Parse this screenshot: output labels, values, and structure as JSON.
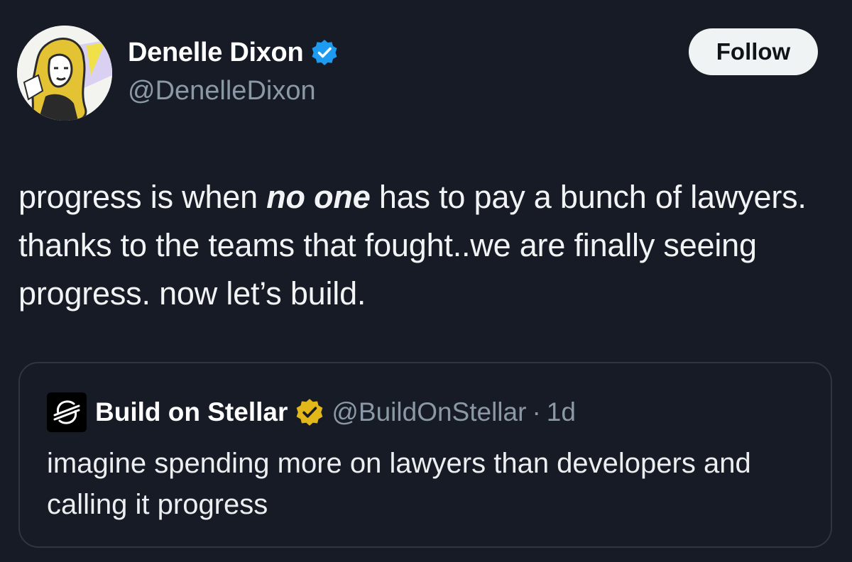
{
  "author": {
    "display_name": "Denelle Dixon",
    "handle": "@DenelleDixon",
    "verified_color": "#1d9bf0",
    "avatar_icon": "illustrated-portrait-avatar"
  },
  "follow_button": {
    "label": "Follow"
  },
  "tweet": {
    "text_before": "progress is when ",
    "text_emphasis": "no one",
    "text_after": " has to pay a bunch of lawyers. thanks to the teams that fought..we are finally seeing progress. now let’s build."
  },
  "quoted_tweet": {
    "display_name": "Build on Stellar",
    "handle": "@BuildOnStellar",
    "separator": "·",
    "time": "1d",
    "verified_color": "#e2b719",
    "logo_icon": "stellar-logo-icon",
    "text": "imagine spending more on lawyers than developers and calling it progress"
  },
  "colors": {
    "background": "#161b25",
    "secondary_text": "#8b98a5",
    "follow_button_bg": "#eff3f4"
  }
}
